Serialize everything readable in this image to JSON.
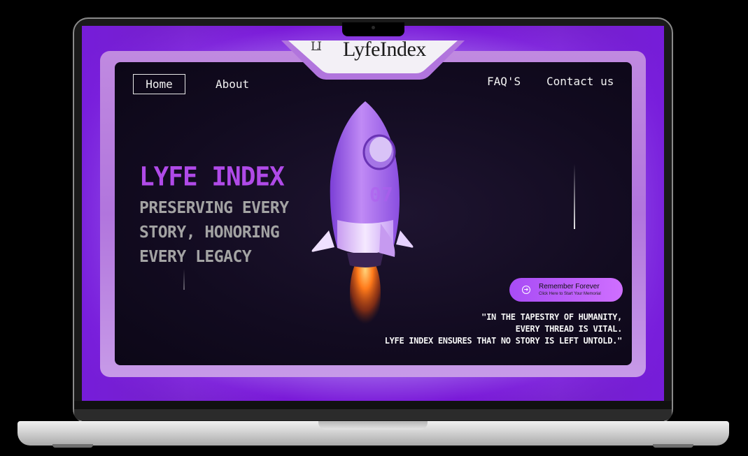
{
  "brand": {
    "logo_mark": "LI",
    "name": "LyfeIndex"
  },
  "nav": {
    "home": "Home",
    "about": "About",
    "faq": "FAQ'S",
    "contact": "Contact us"
  },
  "hero": {
    "title": "LYFE INDEX",
    "tagline": [
      "PRESERVING EVERY",
      "STORY, HONORING",
      "EVERY LEGACY"
    ],
    "rocket_marking": "07"
  },
  "cta": {
    "title": "Remember Forever",
    "subtitle": "Click Here to Start Your Memorial",
    "icon": "arrow-circle-icon"
  },
  "quote": {
    "lines": [
      "\"IN THE TAPESTRY OF HUMANITY,",
      "EVERY THREAD IS VITAL.",
      "LYFE INDEX ENSURES THAT NO STORY IS LEFT UNTOLD.\""
    ]
  },
  "colors": {
    "accent": "#b04ae8",
    "cta_gradient": [
      "#a84cf5",
      "#cf6fff"
    ],
    "panel": "#120b20",
    "frame": "#b175dd"
  }
}
